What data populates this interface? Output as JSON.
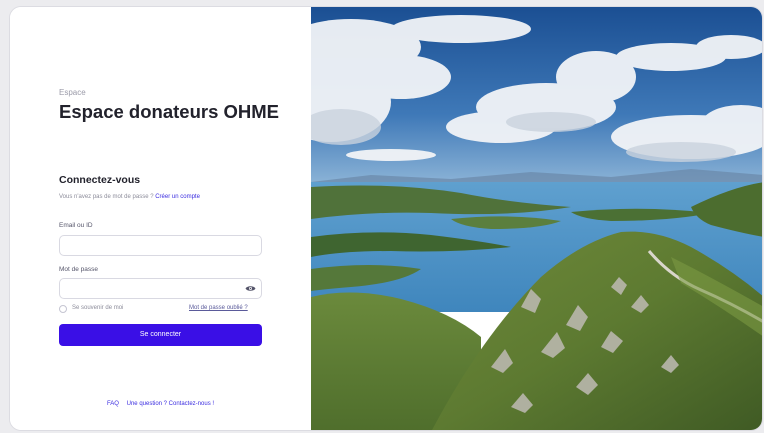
{
  "page": {
    "kicker": "Espace",
    "title": "Espace donateurs OHME"
  },
  "login": {
    "heading": "Connectez-vous",
    "no_account_text": "Vous n'avez pas de mot de passe ?",
    "create_account_link": "Créer un compte",
    "email_label": "Email ou ID",
    "email_value": "",
    "password_label": "Mot de passe",
    "password_value": "",
    "remember_label": "Se souvenir de moi",
    "remember_checked": false,
    "forgot_link": "Mot de passe oublié ?",
    "submit_label": "Se connecter"
  },
  "footer": {
    "faq": "FAQ",
    "contact": "Une question ? Contactez-nous !"
  },
  "colors": {
    "accent": "#3a0fe6",
    "link": "#3b2de0"
  },
  "icons": [
    "eye-icon"
  ]
}
